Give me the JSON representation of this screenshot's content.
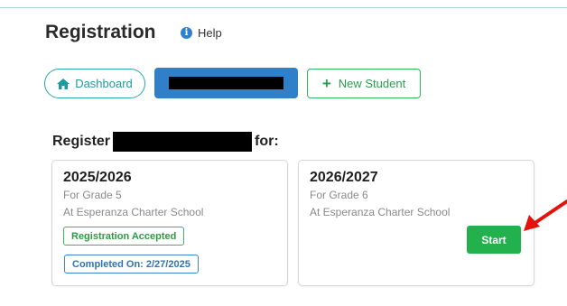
{
  "header": {
    "title": "Registration",
    "help_label": "Help"
  },
  "toolbar": {
    "dashboard_label": "Dashboard",
    "new_student_label": "New Student"
  },
  "register": {
    "prefix": "Register ",
    "suffix": "for:"
  },
  "cards": [
    {
      "year": "2025/2026",
      "grade": "For Grade 5",
      "school": "At Esperanza Charter School",
      "status_badge": "Registration Accepted",
      "completed_badge": "Completed On: 2/27/2025"
    },
    {
      "year": "2026/2027",
      "grade": "For Grade 6",
      "school": "At Esperanza Charter School",
      "start_label": "Start"
    }
  ],
  "colors": {
    "teal": "#2aa7a9",
    "blue": "#2f80c8",
    "green": "#22b14c",
    "annotation_red": "#e3120b"
  },
  "icons": [
    "info-icon",
    "home-icon",
    "plus-icon",
    "annotation-arrow"
  ]
}
